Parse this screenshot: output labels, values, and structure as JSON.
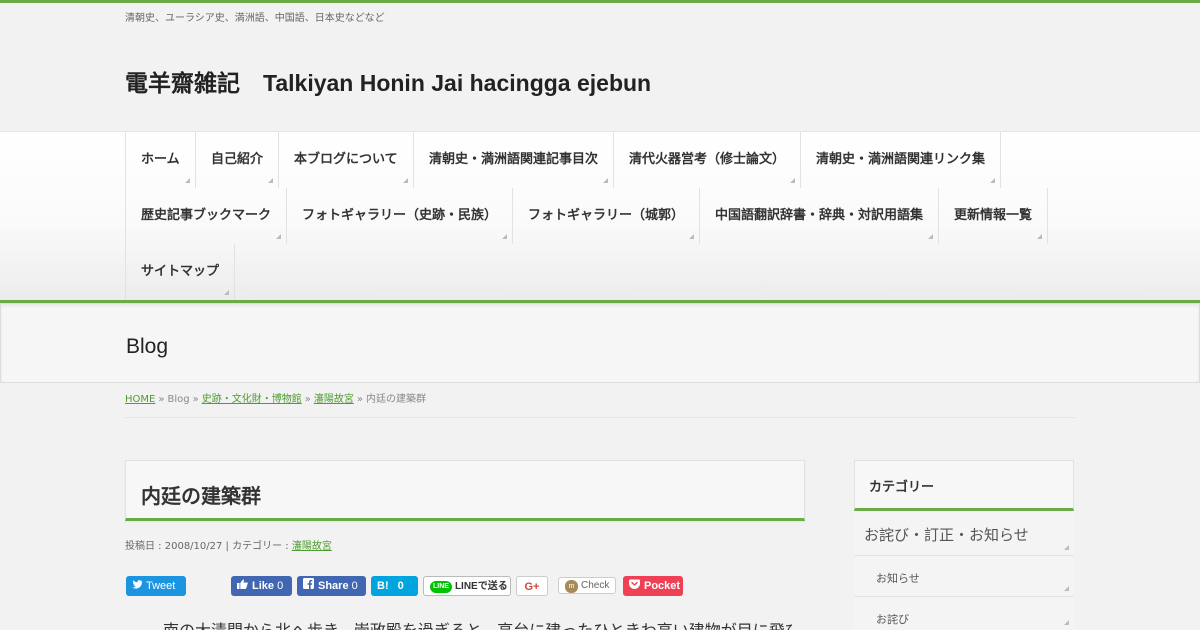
{
  "header": {
    "tagline": "清朝史、ユーラシア史、満洲語、中国語、日本史などなど",
    "site_title": "電羊齋雑記　Talkiyan Honin Jai hacingga ejebun"
  },
  "nav": {
    "items": [
      {
        "label": "ホーム"
      },
      {
        "label": "自己紹介"
      },
      {
        "label": "本ブログについて"
      },
      {
        "label": "清朝史・満洲語関連記事目次"
      },
      {
        "label": "清代火器営考（修士論文）"
      },
      {
        "label": "清朝史・満洲語関連リンク集"
      },
      {
        "label": "歴史記事ブックマーク"
      },
      {
        "label": "フォトギャラリー（史跡・民族）"
      },
      {
        "label": "フォトギャラリー（城郭）"
      },
      {
        "label": "中国語翻訳辞書・辞典・対訳用語集"
      },
      {
        "label": "更新情報一覧"
      },
      {
        "label": "サイトマップ"
      }
    ]
  },
  "section_heading": "Blog",
  "breadcrumb": {
    "home": "HOME",
    "blog": "Blog",
    "cat1": "史跡・文化財・博物館",
    "cat2": "瀋陽故宮",
    "current": "内廷の建築群",
    "sep": "»"
  },
  "post": {
    "title": "内廷の建築群",
    "meta_date_label": "投稿日 : 2008/10/27 | カテゴリー : ",
    "meta_category": "瀋陽故宮",
    "body_first_line": "　南の大清門から北へ歩き、崇政殿を過ぎると、高台に建ったひときわ高い建物が目に飛び"
  },
  "share": {
    "tweet": "Tweet",
    "like": "Like",
    "like_count": "0",
    "share": "Share",
    "share_count": "0",
    "hatena": "B!",
    "hatena_count": "0",
    "line_badge": "LINE",
    "line": "LINEで送る",
    "gplus": "G+",
    "check_badge": "m",
    "check": "Check",
    "pocket": "Pocket"
  },
  "sidebar": {
    "heading": "カテゴリー",
    "categories": [
      {
        "label": "お詫び・訂正・お知らせ"
      },
      {
        "label": "お知らせ"
      },
      {
        "label": "お詫び"
      }
    ]
  },
  "colors": {
    "accent": "#6aab45",
    "link": "#4f9d2f",
    "twitter": "#1b95e0",
    "facebook": "#4267b2",
    "hatena": "#00a4de",
    "pocket": "#ef4056"
  }
}
